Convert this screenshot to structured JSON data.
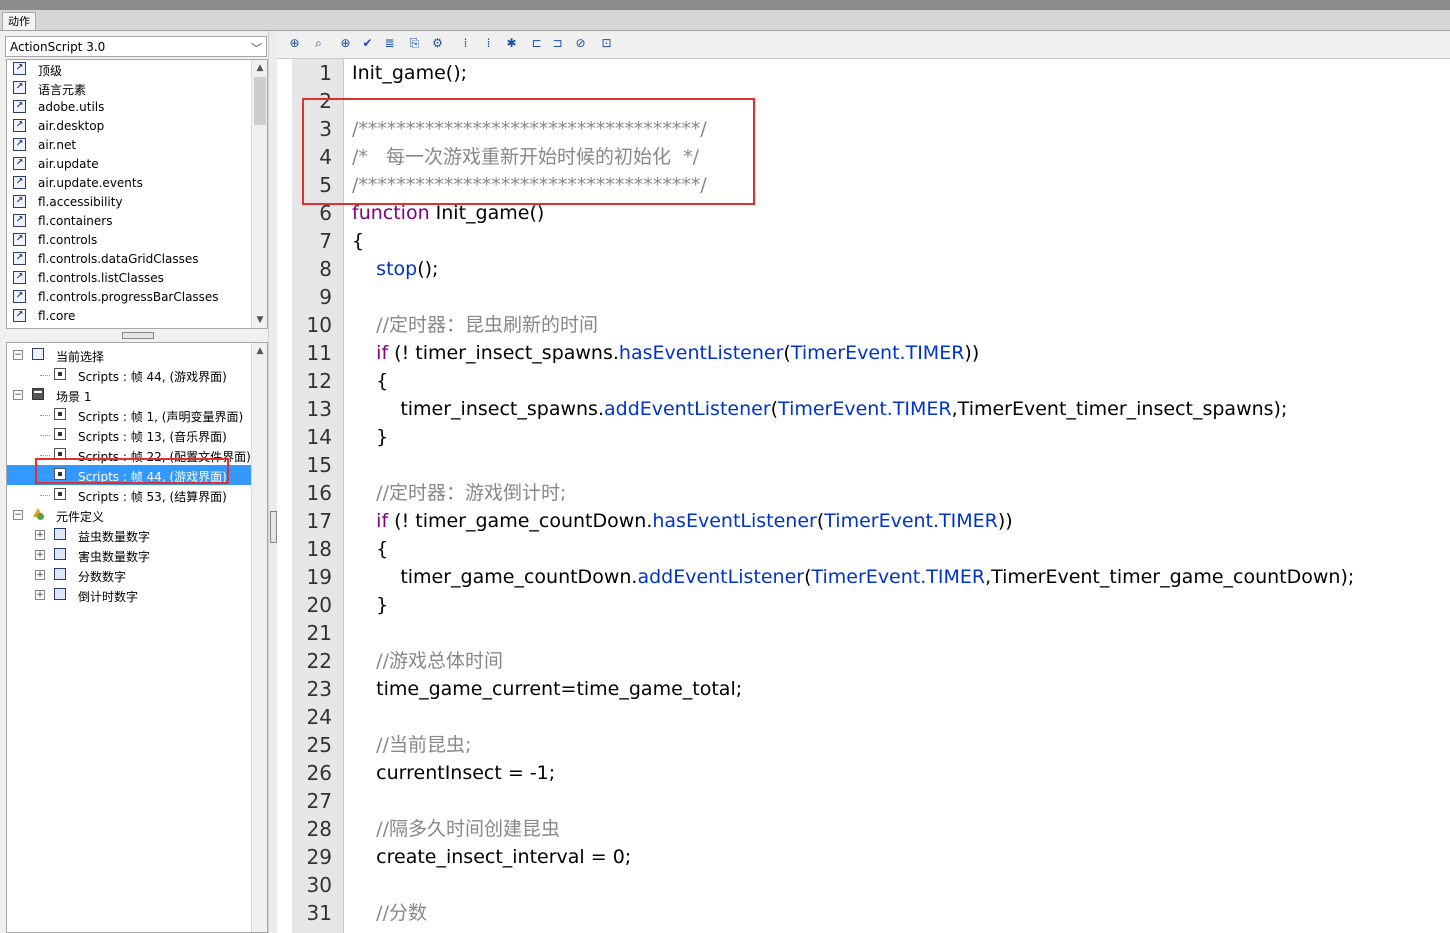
{
  "panel_tab": "动作",
  "language_select": {
    "value": "ActionScript 3.0"
  },
  "library_items": [
    "顶级",
    "语言元素",
    "adobe.utils",
    "air.desktop",
    "air.net",
    "air.update",
    "air.update.events",
    "fl.accessibility",
    "fl.containers",
    "fl.controls",
    "fl.controls.dataGridClasses",
    "fl.controls.listClasses",
    "fl.controls.progressBarClasses",
    "fl.core"
  ],
  "tree": [
    {
      "label": "当前选择",
      "level": 0,
      "icon": "current-selection",
      "expander": "⊟"
    },
    {
      "label": "Scripts : 帧 44, (游戏界面)",
      "level": 1,
      "icon": "script"
    },
    {
      "label": "场景 1",
      "level": 0,
      "icon": "scene",
      "expander": "⊟"
    },
    {
      "label": "Scripts : 帧 1, (声明变量界面)",
      "level": 1,
      "icon": "script"
    },
    {
      "label": "Scripts : 帧 13, (音乐界面)",
      "level": 1,
      "icon": "script"
    },
    {
      "label": "Scripts : 帧 22, (配置文件界面)",
      "level": 1,
      "icon": "script"
    },
    {
      "label": "Scripts : 帧 44, (游戏界面)",
      "level": 1,
      "icon": "script",
      "selected": true
    },
    {
      "label": "Scripts : 帧 53, (结算界面)",
      "level": 1,
      "icon": "script"
    },
    {
      "label": "元件定义",
      "level": 0,
      "icon": "symbols",
      "expander": "⊟"
    },
    {
      "label": "益虫数量数字",
      "level": 1,
      "icon": "graphic",
      "expander": "⊞"
    },
    {
      "label": "害虫数量数字",
      "level": 1,
      "icon": "graphic",
      "expander": "⊞"
    },
    {
      "label": "分数数字",
      "level": 1,
      "icon": "graphic",
      "expander": "⊞"
    },
    {
      "label": "倒计时数字",
      "level": 1,
      "icon": "graphic",
      "expander": "⊞"
    }
  ],
  "toolbar_icons": [
    "add-statement-icon",
    "find-icon",
    "insert-target-path-icon",
    "check-syntax-icon",
    "auto-format-icon",
    "show-code-hint-icon",
    "debug-options-icon",
    "collapse-between-braces-icon",
    "collapse-selection-icon",
    "expand-all-icon",
    "apply-block-comment-icon",
    "apply-line-comment-icon",
    "remove-comment-icon",
    "show-hide-toolbox-icon"
  ],
  "code": [
    {
      "n": "1",
      "tokens": [
        [
          "tx",
          "Init_game();"
        ]
      ]
    },
    {
      "n": "2",
      "tokens": []
    },
    {
      "n": "3",
      "tokens": [
        [
          "cm",
          "/************************************/"
        ]
      ]
    },
    {
      "n": "4",
      "tokens": [
        [
          "cm",
          "/*   每一次游戏重新开始时候的初始化  */"
        ]
      ]
    },
    {
      "n": "5",
      "tokens": [
        [
          "cm",
          "/************************************/"
        ]
      ]
    },
    {
      "n": "6",
      "tokens": [
        [
          "kw",
          "function"
        ],
        [
          "tx",
          " Init_game()"
        ]
      ]
    },
    {
      "n": "7",
      "tokens": [
        [
          "tx",
          "{"
        ]
      ]
    },
    {
      "n": "8",
      "tokens": [
        [
          "tx",
          "    "
        ],
        [
          "fn",
          "stop"
        ],
        [
          "tx",
          "();"
        ]
      ]
    },
    {
      "n": "9",
      "tokens": []
    },
    {
      "n": "10",
      "tokens": [
        [
          "tx",
          "    "
        ],
        [
          "cm",
          "//定时器：昆虫刷新的时间"
        ]
      ]
    },
    {
      "n": "11",
      "tokens": [
        [
          "tx",
          "    "
        ],
        [
          "kw",
          "if"
        ],
        [
          "tx",
          " (! timer_insect_spawns."
        ],
        [
          "fn",
          "hasEventListener"
        ],
        [
          "tx",
          "("
        ],
        [
          "fn",
          "TimerEvent.TIMER"
        ],
        [
          "tx",
          "))"
        ]
      ]
    },
    {
      "n": "12",
      "tokens": [
        [
          "tx",
          "    {"
        ]
      ]
    },
    {
      "n": "13",
      "tokens": [
        [
          "tx",
          "        timer_insect_spawns."
        ],
        [
          "fn",
          "addEventListener"
        ],
        [
          "tx",
          "("
        ],
        [
          "fn",
          "TimerEvent.TIMER"
        ],
        [
          "tx",
          ",TimerEvent_timer_insect_spawns);"
        ]
      ]
    },
    {
      "n": "14",
      "tokens": [
        [
          "tx",
          "    }"
        ]
      ]
    },
    {
      "n": "15",
      "tokens": []
    },
    {
      "n": "16",
      "tokens": [
        [
          "tx",
          "    "
        ],
        [
          "cm",
          "//定时器：游戏倒计时;"
        ]
      ]
    },
    {
      "n": "17",
      "tokens": [
        [
          "tx",
          "    "
        ],
        [
          "kw",
          "if"
        ],
        [
          "tx",
          " (! timer_game_countDown."
        ],
        [
          "fn",
          "hasEventListener"
        ],
        [
          "tx",
          "("
        ],
        [
          "fn",
          "TimerEvent.TIMER"
        ],
        [
          "tx",
          "))"
        ]
      ]
    },
    {
      "n": "18",
      "tokens": [
        [
          "tx",
          "    {"
        ]
      ]
    },
    {
      "n": "19",
      "tokens": [
        [
          "tx",
          "        timer_game_countDown."
        ],
        [
          "fn",
          "addEventListener"
        ],
        [
          "tx",
          "("
        ],
        [
          "fn",
          "TimerEvent.TIMER"
        ],
        [
          "tx",
          ",TimerEvent_timer_game_countDown);"
        ]
      ]
    },
    {
      "n": "20",
      "tokens": [
        [
          "tx",
          "    }"
        ]
      ]
    },
    {
      "n": "21",
      "tokens": []
    },
    {
      "n": "22",
      "tokens": [
        [
          "tx",
          "    "
        ],
        [
          "cm",
          "//游戏总体时间"
        ]
      ]
    },
    {
      "n": "23",
      "tokens": [
        [
          "tx",
          "    time_game_current=time_game_total;"
        ]
      ]
    },
    {
      "n": "24",
      "tokens": []
    },
    {
      "n": "25",
      "tokens": [
        [
          "tx",
          "    "
        ],
        [
          "cm",
          "//当前昆虫;"
        ]
      ]
    },
    {
      "n": "26",
      "tokens": [
        [
          "tx",
          "    currentInsect = -1;"
        ]
      ]
    },
    {
      "n": "27",
      "tokens": []
    },
    {
      "n": "28",
      "tokens": [
        [
          "tx",
          "    "
        ],
        [
          "cm",
          "//隔多久时间创建昆虫"
        ]
      ]
    },
    {
      "n": "29",
      "tokens": [
        [
          "tx",
          "    create_insect_interval = 0;"
        ]
      ]
    },
    {
      "n": "30",
      "tokens": []
    },
    {
      "n": "31",
      "tokens": [
        [
          "tx",
          "    "
        ],
        [
          "cm",
          "//分数"
        ]
      ]
    }
  ]
}
